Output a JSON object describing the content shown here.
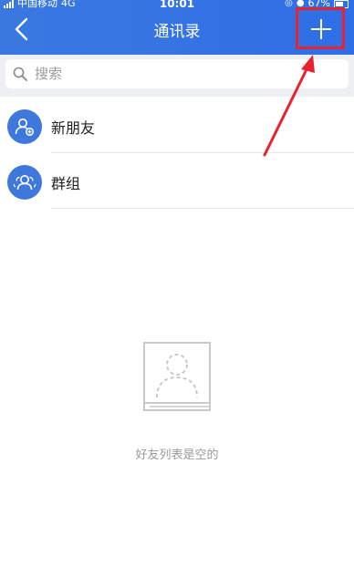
{
  "status_bar": {
    "carrier": "中国移动",
    "network": "4G",
    "time": "10:01",
    "battery": "67%"
  },
  "nav": {
    "title": "通讯录",
    "back_icon": "chevron-left-icon",
    "add_icon": "plus-icon"
  },
  "search": {
    "placeholder": "搜索",
    "value": ""
  },
  "list": [
    {
      "label": "新朋友",
      "icon": "add-friend-icon"
    },
    {
      "label": "群组",
      "icon": "group-icon"
    }
  ],
  "empty_state": {
    "text": "好友列表是空的",
    "icon": "empty-contacts-icon"
  },
  "colors": {
    "header": "#2f6fe6",
    "accent": "#3f78dc",
    "annotation": "#e8222e"
  }
}
